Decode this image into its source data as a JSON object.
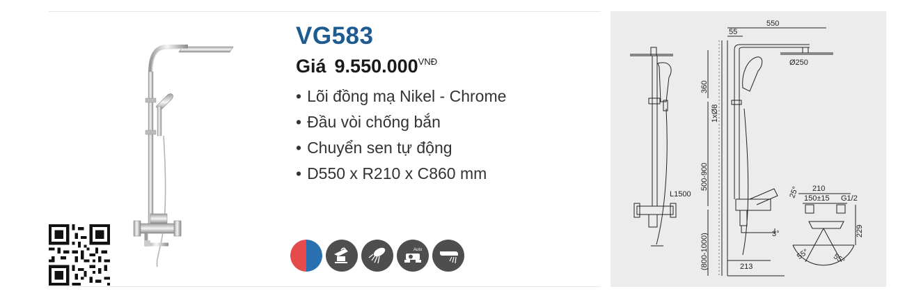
{
  "product": {
    "model": "VG583",
    "price_label": "Giá",
    "price_amount": "9.550.000",
    "currency": "VNĐ",
    "features": [
      "Lõi đồng mạ Nikel - Chrome",
      "Đầu vòi chống bắn",
      "Chuyển sen tự động",
      "D550 x R210 x C860 mm"
    ],
    "feature_icons": [
      "hot-cold-icon",
      "faucet-icon",
      "shower-head-icon",
      "auto-diverter-icon",
      "spout-icon"
    ],
    "auto_label": "Auto"
  },
  "drawing": {
    "dim_550": "550",
    "dim_55": "55",
    "dim_360": "360",
    "dim_1x08": "1xØ8",
    "dim_250": "Ø250",
    "dim_500_900": "500-900",
    "dim_800_1000": "(800-1000)",
    "dim_l1500": "L1500",
    "dim_25": "25°",
    "dim_210": "210",
    "dim_150": "150±15",
    "dim_g12": "G1/2",
    "dim_229": "229",
    "dim_3": "3°",
    "dim_213": "213",
    "dim_55a": "55°",
    "dim_55b": "55°"
  },
  "colors": {
    "model": "#1d5b91",
    "hot": "#e54b4b",
    "cold": "#2a6fb0",
    "icon_bg": "#4e4e4e",
    "drawing_bg": "#ececec"
  }
}
